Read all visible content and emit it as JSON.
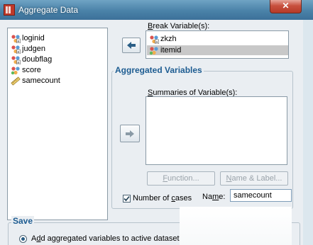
{
  "window": {
    "title": "Aggregate Data",
    "close_glyph": "✕"
  },
  "source_vars": [
    {
      "name": "loginid",
      "icon": "nominal-string-icon"
    },
    {
      "name": "judgen",
      "icon": "nominal-string-icon"
    },
    {
      "name": "doubflag",
      "icon": "nominal-string-icon"
    },
    {
      "name": "score",
      "icon": "nominal-numeric-icon"
    },
    {
      "name": "samecount",
      "icon": "scale-ruler-icon"
    }
  ],
  "break": {
    "label_first": "B",
    "label_rest": "reak Variable(s):",
    "items": [
      {
        "name": "zkzh",
        "icon": "nominal-string-icon",
        "selected": false
      },
      {
        "name": "itemid",
        "icon": "nominal-numeric-icon",
        "selected": true
      }
    ]
  },
  "aggregated": {
    "group_title": "Aggregated Variables",
    "summaries_first": "S",
    "summaries_rest": "ummaries of Variable(s):",
    "function_btn": {
      "pre": "",
      "u": "F",
      "post": "unction..."
    },
    "name_label_btn": {
      "pre": "",
      "u": "N",
      "post": "ame & Label..."
    },
    "num_cases_pre": "Number of ",
    "num_cases_u": "c",
    "num_cases_post": "ases",
    "num_cases_checked": true,
    "name_label_pre": "Na",
    "name_label_u": "m",
    "name_label_post": "e:",
    "name_value": "samecount"
  },
  "save": {
    "group_title": "Save",
    "option_pre": "A",
    "option_u": "d",
    "option_post": "d aggregated variables to active dataset"
  },
  "colors": {
    "title_bar": "#4a82a8",
    "group_title": "#1d5c91",
    "close": "#c8503e",
    "selection": "#c8c8c8"
  }
}
